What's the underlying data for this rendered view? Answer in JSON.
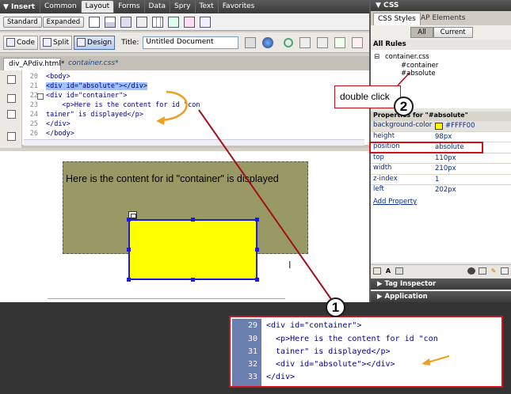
{
  "insert_bar": {
    "title": "▼ Insert",
    "tabs": [
      "Common",
      "Layout",
      "Forms",
      "Data",
      "Spry",
      "Text",
      "Favorites"
    ],
    "active_tab": "Layout",
    "standard_label": "Standard",
    "expanded_label": "Expanded"
  },
  "doc_toolbar": {
    "code_label": "Code",
    "split_label": "Split",
    "design_label": "Design",
    "title_label": "Title:",
    "title_value": "Untitled Document"
  },
  "doc_tabs": {
    "active": "div_APdiv.html*",
    "related": "container.css*"
  },
  "code_view": {
    "line_numbers": [
      "20",
      "21",
      "22",
      "23",
      "24",
      "25",
      "26"
    ],
    "lines": [
      "<body>",
      "<div id=\"absolute\"></div>",
      "<div id=\"container\">",
      "    <p>Here is the content for id \"con",
      "tainer\" is displayed</p>",
      "</div>",
      "</body>"
    ]
  },
  "design_view": {
    "container_text": "Here is the content for id \"container\" is displayed",
    "colors": {
      "container_bg": "#999966",
      "absolute_bg": "#ffff00",
      "selection": "#1a1ae0"
    }
  },
  "css_panel": {
    "header": "▼ CSS",
    "tabs": [
      "CSS Styles",
      "AP Elements"
    ],
    "active_tab": "CSS Styles",
    "mode_buttons": [
      "All",
      "Current"
    ],
    "active_mode": "All",
    "all_rules_label": "All Rules",
    "rules": {
      "file": "container.css",
      "children": [
        "#container",
        "#absolute"
      ]
    },
    "properties_header": "Properties for \"#absolute\"",
    "properties": [
      {
        "name": "background-color",
        "value": "#FFFF00",
        "swatch": "#ffff00"
      },
      {
        "name": "height",
        "value": "98px"
      },
      {
        "name": "position",
        "value": "absolute"
      },
      {
        "name": "top",
        "value": "110px"
      },
      {
        "name": "width",
        "value": "210px"
      },
      {
        "name": "z-index",
        "value": "1"
      },
      {
        "name": "left",
        "value": "202px"
      }
    ],
    "add_property": "Add Property",
    "tag_inspector": "▶ Tag Inspector",
    "application": "▶ Application"
  },
  "callouts": {
    "double_click": "double click",
    "badge_1": "1",
    "badge_2": "2"
  },
  "bottom_code": {
    "line_numbers": [
      "29",
      "30",
      "31",
      "32",
      "33"
    ],
    "lines": [
      "<div id=\"container\">",
      "  <p>Here is the content for id \"con",
      "  tainer\" is displayed</p>",
      "  <div id=\"absolute\"></div>",
      "</div>"
    ]
  }
}
